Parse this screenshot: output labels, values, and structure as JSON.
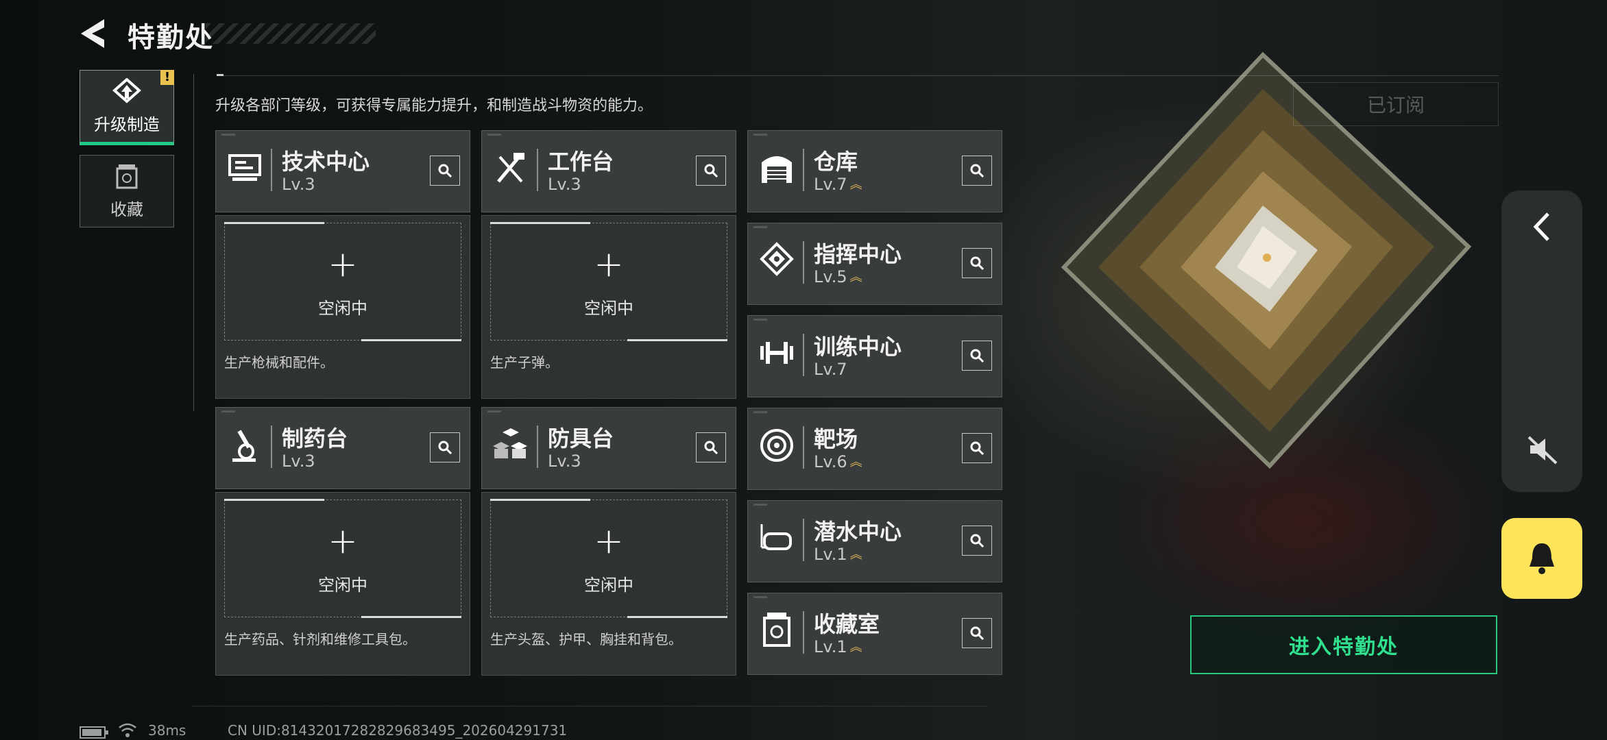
{
  "header": {
    "title": "特勤处"
  },
  "tabs": [
    {
      "label": "升级制造",
      "active": true,
      "icon": "upgrade-icon",
      "badge": "!"
    },
    {
      "label": "收藏",
      "active": false,
      "icon": "collection-icon"
    }
  ],
  "description": "升级各部门等级，可获得专属能力提升，和制造战斗物资的能力。",
  "subscribed_label": "已订阅",
  "production": [
    {
      "name": "技术中心",
      "level": "Lv.3",
      "icon": "tech-center-icon",
      "slot_plus": "+",
      "slot_status": "空闲中",
      "note": "生产枪械和配件。"
    },
    {
      "name": "工作台",
      "level": "Lv.3",
      "icon": "workbench-icon",
      "slot_plus": "+",
      "slot_status": "空闲中",
      "note": "生产子弹。"
    },
    {
      "name": "制药台",
      "level": "Lv.3",
      "icon": "pharmacy-icon",
      "slot_plus": "+",
      "slot_status": "空闲中",
      "note": "生产药品、针剂和维修工具包。"
    },
    {
      "name": "防具台",
      "level": "Lv.3",
      "icon": "armor-bench-icon",
      "slot_plus": "+",
      "slot_status": "空闲中",
      "note": "生产头盔、护甲、胸挂和背包。"
    }
  ],
  "departments": [
    {
      "name": "仓库",
      "level": "Lv.7",
      "upgradable": true,
      "icon": "warehouse-icon"
    },
    {
      "name": "指挥中心",
      "level": "Lv.5",
      "upgradable": true,
      "icon": "command-center-icon"
    },
    {
      "name": "训练中心",
      "level": "Lv.7",
      "upgradable": false,
      "icon": "training-center-icon"
    },
    {
      "name": "靶场",
      "level": "Lv.6",
      "upgradable": true,
      "icon": "shooting-range-icon"
    },
    {
      "name": "潜水中心",
      "level": "Lv.1",
      "upgradable": true,
      "icon": "diving-center-icon"
    },
    {
      "name": "收藏室",
      "level": "Lv.1",
      "upgradable": true,
      "icon": "collection-room-icon"
    }
  ],
  "enter_button": "进入特勤处",
  "status_bar": {
    "ping": "38ms",
    "uid": "CN UID:8143201728282968349​5_202604291731"
  },
  "colors": {
    "accent_green": "#24c97f",
    "upgrade_gold": "#e2b85a",
    "bell_yellow": "#fde45b",
    "card_bg": "#393c3c"
  }
}
